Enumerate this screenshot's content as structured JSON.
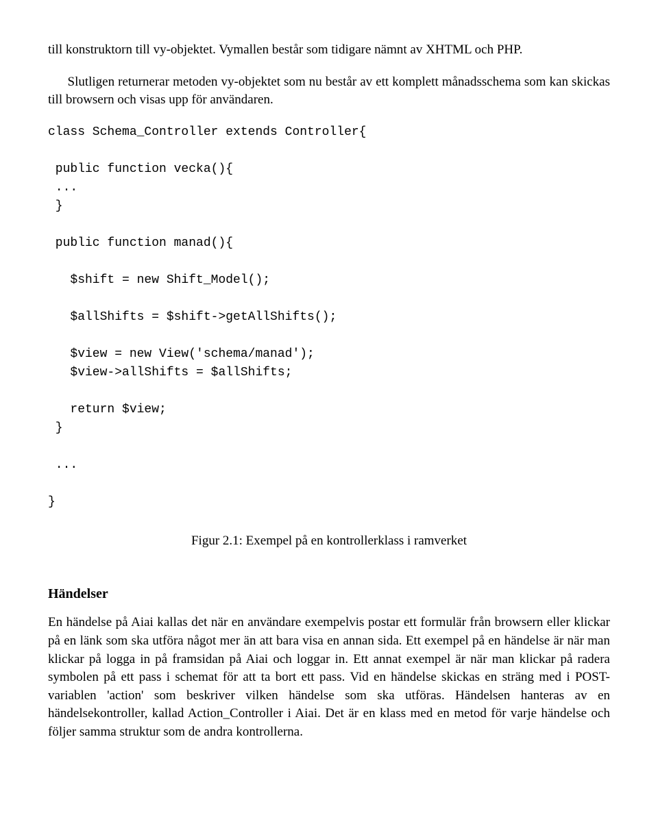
{
  "paragraph1": "till konstruktorn till vy-objektet. Vymallen består som tidigare nämnt av XHTML och PHP.",
  "paragraph2": "Slutligen returnerar metoden vy-objektet som nu består av ett komplett månadsschema som kan skickas till browsern och visas upp för användaren.",
  "code": "class Schema_Controller extends Controller{\n\n public function vecka(){\n ...\n }\n\n public function manad(){\n\n   $shift = new Shift_Model();\n\n   $allShifts = $shift->getAllShifts();\n\n   $view = new View('schema/manad');\n   $view->allShifts = $allShifts;\n\n   return $view;\n }\n\n ...\n\n}",
  "figureCaption": "Figur 2.1: Exempel på en kontrollerklass i ramverket",
  "subheading": "Händelser",
  "paragraph3": "En händelse på Aiai kallas det när en användare exempelvis postar ett formulär från browsern eller klickar på en länk som ska utföra något mer än att bara visa en annan sida. Ett exempel på en händelse är när man klickar på logga in på framsidan på Aiai och loggar in. Ett annat exempel är när man klickar på radera symbolen på ett pass i schemat för att ta bort ett pass. Vid en händelse skickas en sträng med i POST-variablen 'action' som beskriver vilken händelse som ska utföras. Händelsen hanteras av en händelsekontroller, kallad Action_Controller i Aiai. Det är en klass med en metod för varje händelse och följer samma struktur som de andra kontrollerna."
}
